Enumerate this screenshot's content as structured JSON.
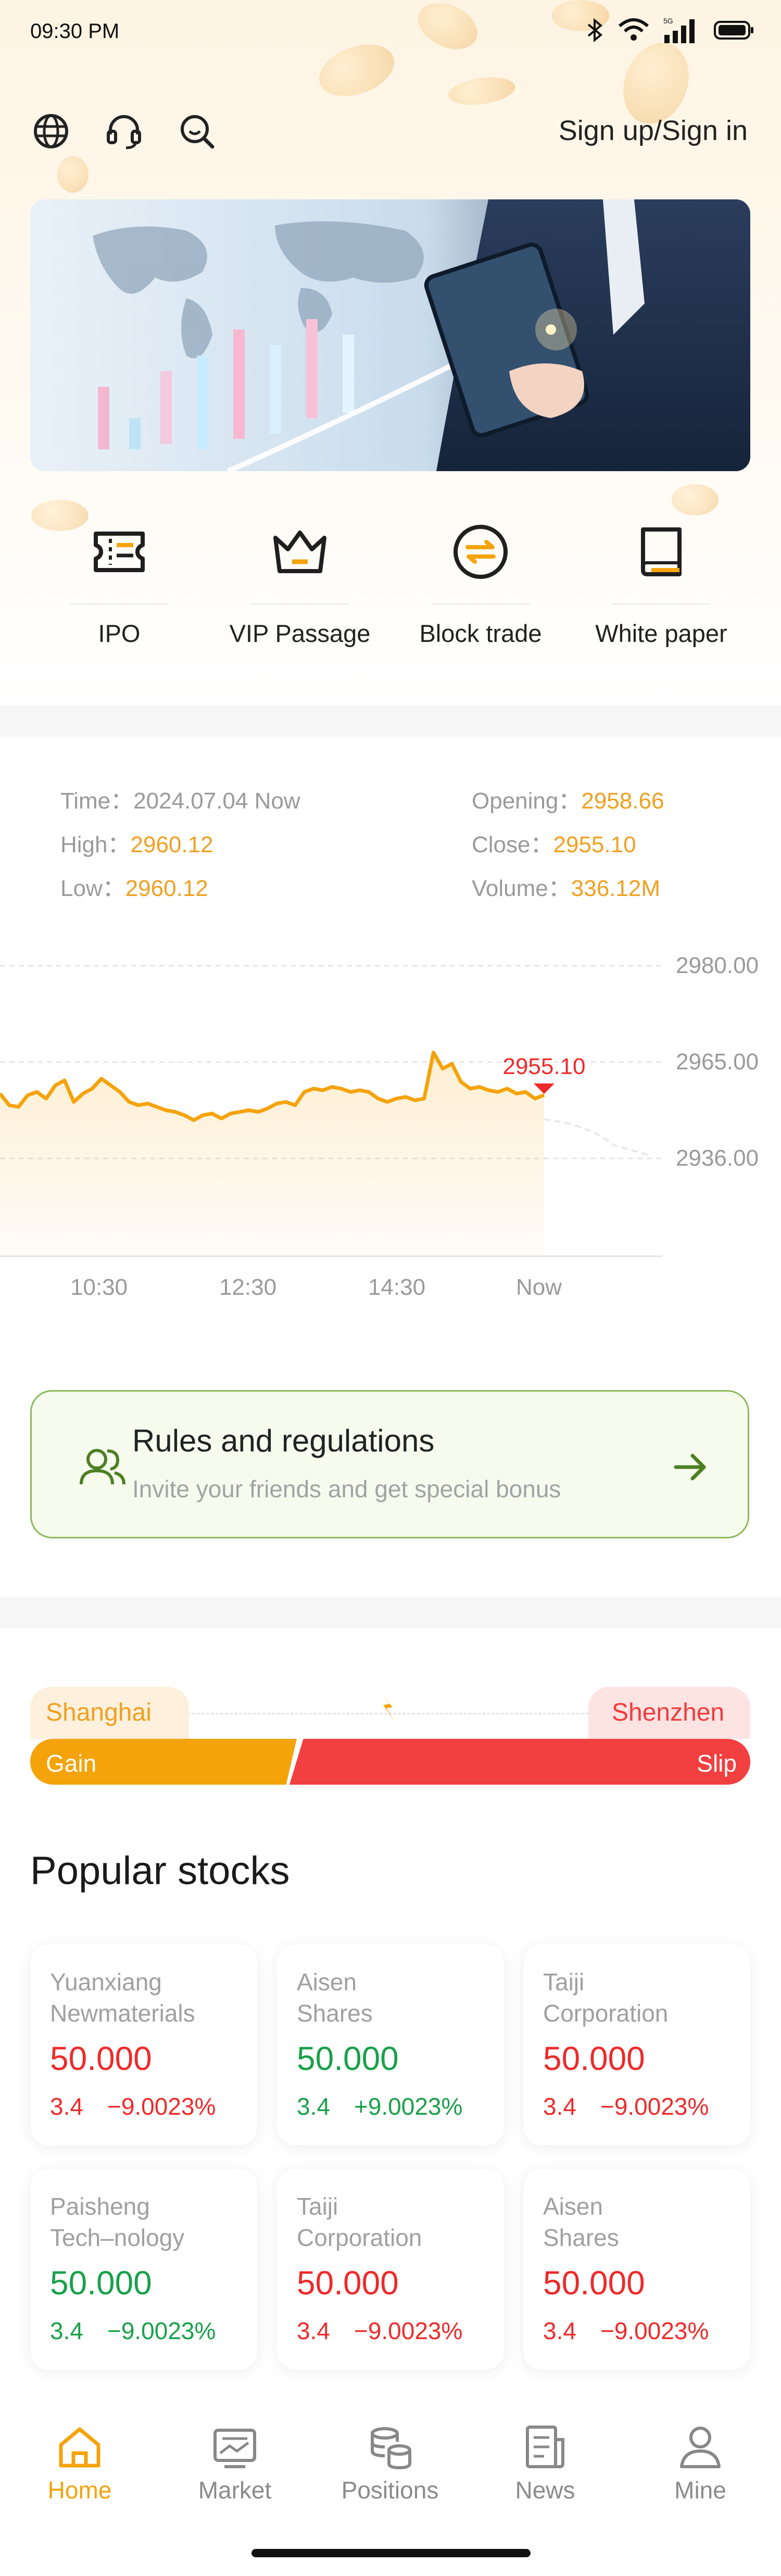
{
  "status_bar": {
    "time": "09:30 PM"
  },
  "header": {
    "signin_label": "Sign up/Sign in"
  },
  "quick_menu": [
    {
      "label": "IPO",
      "icon": "ticket-icon"
    },
    {
      "label": "VIP Passage",
      "icon": "crown-icon"
    },
    {
      "label": "Block trade",
      "icon": "exchange-icon"
    },
    {
      "label": "White paper",
      "icon": "book-icon"
    }
  ],
  "market_info": {
    "time_label": "Time：",
    "time_value": "2024.07.04 Now",
    "opening_label": "Opening：",
    "opening_value": "2958.66",
    "high_label": "High：",
    "high_value": "2960.12",
    "close_label": "Close：",
    "close_value": "2955.10",
    "low_label": "Low：",
    "low_value": "2960.12",
    "volume_label": "Volume：",
    "volume_value": "336.12M"
  },
  "chart_data": {
    "type": "line",
    "y_ticks": [
      "2980.00",
      "2965.00",
      "2936.00"
    ],
    "x_ticks": [
      "10:30",
      "12:30",
      "14:30",
      "Now"
    ],
    "current_label": "2955.10",
    "series": [
      {
        "values": [
          2955.5,
          2952,
          2951.5,
          2955,
          2956,
          2954,
          2958,
          2959.5,
          2953,
          2955.5,
          2957,
          2960,
          2958,
          2956,
          2953,
          2952,
          2952.5,
          2951.5,
          2950.5,
          2950,
          2949,
          2947.5,
          2949,
          2949.5,
          2948,
          2949.5,
          2950,
          2950.5,
          2950,
          2951,
          2952.5,
          2953,
          2952,
          2956,
          2957,
          2956.5,
          2957.5,
          2957,
          2956,
          2956.5,
          2956,
          2954,
          2953,
          2954,
          2954.5,
          2953.5,
          2954,
          2966.5,
          2963,
          2964.5,
          2959,
          2957,
          2957.5,
          2956.5,
          2956,
          2957,
          2955.5,
          2956,
          2954,
          2955.1
        ]
      }
    ]
  },
  "rules_card": {
    "title": "Rules and regulations",
    "subtitle": "Invite your friends and get special bonus"
  },
  "gain_slip": {
    "left_market": "Shanghai",
    "right_market": "Shenzhen",
    "gain_label": "Gain",
    "slip_label": "Slip",
    "gain_fraction": 0.37
  },
  "popular": {
    "title": "Popular stocks",
    "stocks": [
      {
        "name1": "Yuanxiang",
        "name2": "Newmaterials",
        "price": "50.000",
        "change": "3.4",
        "percent": "−9.0023%",
        "trend": "red"
      },
      {
        "name1": "Aisen",
        "name2": "Shares",
        "price": "50.000",
        "change": "3.4",
        "percent": "+9.0023%",
        "trend": "green"
      },
      {
        "name1": "Taiji",
        "name2": "Corporation",
        "price": "50.000",
        "change": "3.4",
        "percent": "−9.0023%",
        "trend": "red"
      },
      {
        "name1": "Paisheng",
        "name2": "Tech–nology",
        "price": "50.000",
        "change": "3.4",
        "percent": "−9.0023%",
        "trend": "green"
      },
      {
        "name1": "Taiji",
        "name2": "Corporation",
        "price": "50.000",
        "change": "3.4",
        "percent": "−9.0023%",
        "trend": "red"
      },
      {
        "name1": "Aisen",
        "name2": "Shares",
        "price": "50.000",
        "change": "3.4",
        "percent": "−9.0023%",
        "trend": "red"
      }
    ]
  },
  "bottom_nav": [
    {
      "label": "Home",
      "icon": "home-icon",
      "active": true
    },
    {
      "label": "Market",
      "icon": "market-icon",
      "active": false
    },
    {
      "label": "Positions",
      "icon": "positions-icon",
      "active": false
    },
    {
      "label": "News",
      "icon": "news-icon",
      "active": false
    },
    {
      "label": "Mine",
      "icon": "user-icon",
      "active": false
    }
  ],
  "colors": {
    "accent": "#f5a30a",
    "rise": "#ee2a2a",
    "fall": "#19a14a",
    "rules_border": "#8cb85a"
  }
}
